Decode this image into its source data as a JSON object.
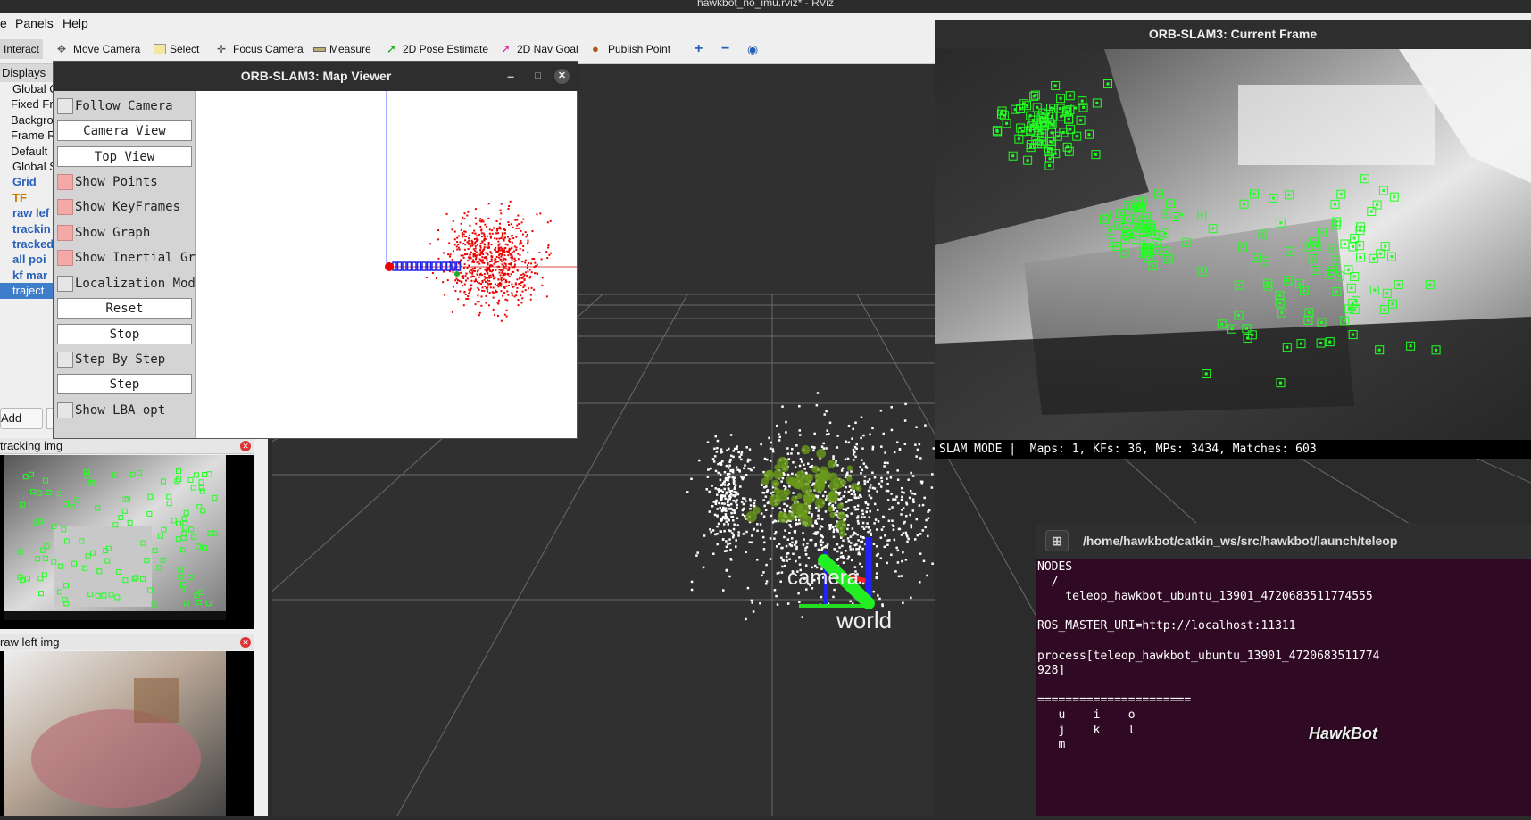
{
  "window_title": "hawkbot_no_imu.rviz* - RViz",
  "menu": {
    "file": "e",
    "panels": "Panels",
    "help": "Help"
  },
  "toolbar": {
    "interact": "Interact",
    "move_camera": "Move Camera",
    "select": "Select",
    "focus_camera": "Focus Camera",
    "measure": "Measure",
    "pose_estimate": "2D Pose Estimate",
    "nav_goal": "2D Nav Goal",
    "publish_point": "Publish Point"
  },
  "displays": {
    "header": "Displays",
    "items": [
      {
        "label": "Global O",
        "style": "normal"
      },
      {
        "label": "Fixed Fr",
        "style": "normal"
      },
      {
        "label": "Backgro",
        "style": "normal"
      },
      {
        "label": "Frame R",
        "style": "normal"
      },
      {
        "label": "Default",
        "style": "normal"
      },
      {
        "label": "Global S",
        "style": "normal"
      },
      {
        "label": "Grid",
        "style": "blue"
      },
      {
        "label": "TF",
        "style": "orange"
      },
      {
        "label": "raw lef",
        "style": "blue"
      },
      {
        "label": "trackin",
        "style": "blue"
      },
      {
        "label": "tracked",
        "style": "blue"
      },
      {
        "label": "all poi",
        "style": "blue"
      },
      {
        "label": "kf mar",
        "style": "blue"
      },
      {
        "label": "traject",
        "style": "selected"
      }
    ],
    "add_button": "Add"
  },
  "image_panels": {
    "tracking": {
      "title": "tracking img"
    },
    "raw": {
      "title": "raw left img"
    }
  },
  "map_viewer": {
    "title": "ORB-SLAM3: Map Viewer",
    "follow_camera": "Follow Camera",
    "camera_view": "Camera View",
    "top_view": "Top View",
    "show_points": "Show Points",
    "show_keyframes": "Show KeyFrames",
    "show_graph": "Show Graph",
    "show_inertial_graph": "Show Inertial Graph",
    "localization_mode": "Localization Mode",
    "reset": "Reset",
    "stop": "Stop",
    "step_by_step": "Step By Step",
    "step": "Step",
    "show_lba_opt": "Show LBA opt"
  },
  "current_frame": {
    "title": "ORB-SLAM3: Current Frame",
    "status": "SLAM MODE |  Maps: 1, KFs: 36, MPs: 3434, Matches: 603"
  },
  "scene": {
    "frame_label_camera": "camera",
    "frame_label_world": "world"
  },
  "terminal": {
    "path": "/home/hawkbot/catkin_ws/src/hawkbot/launch/teleop",
    "lines": [
      "NODES",
      "  /",
      "    teleop_hawkbot_ubuntu_13901_4720683511774555",
      "",
      "ROS_MASTER_URI=http://localhost:11311",
      "",
      "process[teleop_hawkbot_ubuntu_13901_4720683511774",
      "928]",
      "",
      "======================",
      "   u    i    o",
      "   j    k    l",
      "   m"
    ]
  },
  "watermark": "HawkBot"
}
